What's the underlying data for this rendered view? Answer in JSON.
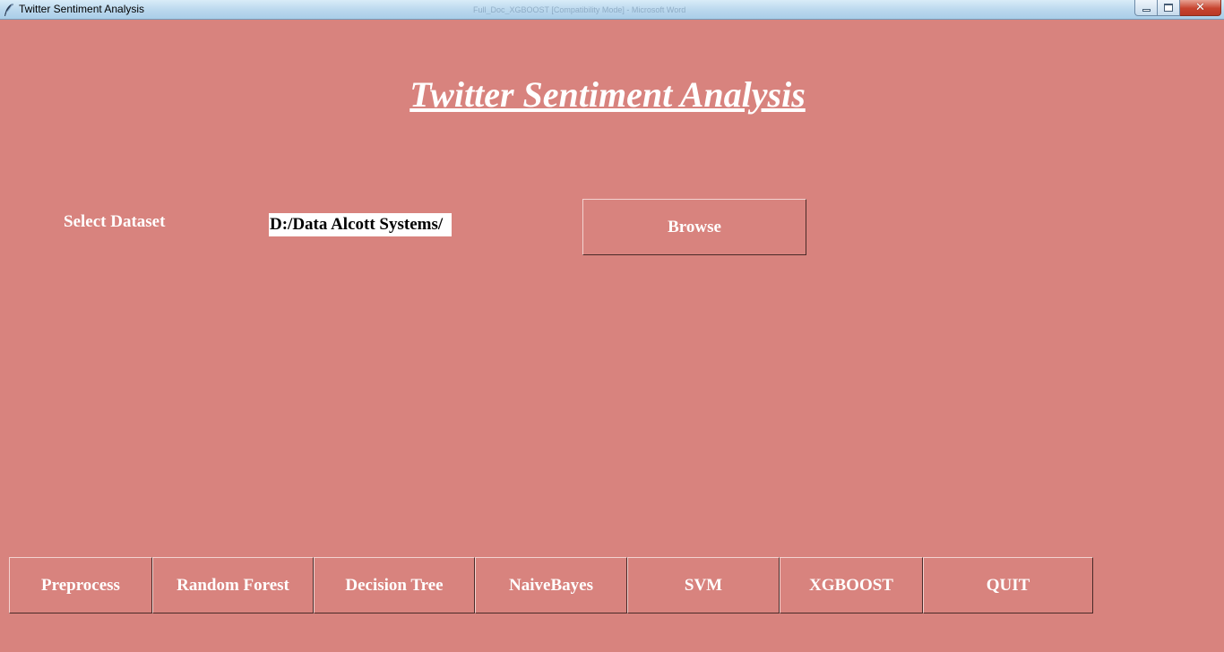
{
  "window": {
    "title": "Twitter Sentiment Analysis",
    "background_title": "Full_Doc_XGBOOST [Compatibility Mode] - Microsoft Word",
    "icon": "feather-icon"
  },
  "main": {
    "heading": "Twitter Sentiment Analysis",
    "select_label": "Select Dataset",
    "dataset_path": "D:/Data Alcott Systems/",
    "browse_label": "Browse"
  },
  "toolbar": {
    "buttons": [
      {
        "id": "preprocess",
        "label": "Preprocess"
      },
      {
        "id": "random-forest",
        "label": "Random Forest"
      },
      {
        "id": "decision-tree",
        "label": "Decision Tree"
      },
      {
        "id": "naive-bayes",
        "label": "NaiveBayes"
      },
      {
        "id": "svm",
        "label": "SVM"
      },
      {
        "id": "xgboost",
        "label": "XGBOOST"
      },
      {
        "id": "quit",
        "label": "QUIT"
      }
    ]
  },
  "colors": {
    "background": "#d8837e",
    "text": "#ffffff",
    "input_bg": "#ffffff"
  }
}
